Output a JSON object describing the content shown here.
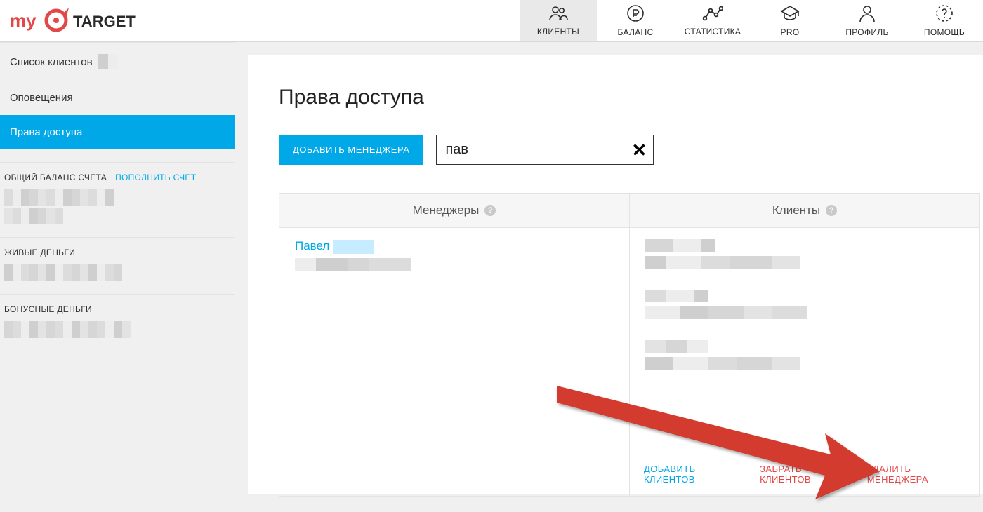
{
  "logo": {
    "text_left": "my",
    "text_right": "TARGET"
  },
  "topnav": [
    {
      "name": "clients",
      "label": "КЛИЕНТЫ",
      "active": true
    },
    {
      "name": "balance",
      "label": "БАЛАНС",
      "active": false
    },
    {
      "name": "stats",
      "label": "СТАТИСТИКА",
      "active": false
    },
    {
      "name": "pro",
      "label": "PRO",
      "active": false
    },
    {
      "name": "profile",
      "label": "ПРОФИЛЬ",
      "active": false
    },
    {
      "name": "help",
      "label": "ПОМОЩЬ",
      "active": false
    }
  ],
  "sidebar": {
    "items": [
      {
        "label": "Список клиентов",
        "active": false
      },
      {
        "label": "Оповещения",
        "active": false
      },
      {
        "label": "Права доступа",
        "active": true
      }
    ],
    "balance_header": "ОБЩИЙ БАЛАНС СЧЕТА",
    "balance_link": "ПОПОЛНИТЬ СЧЕТ",
    "live_money": "ЖИВЫЕ ДЕНЬГИ",
    "bonus_money": "БОНУСНЫЕ ДЕНЬГИ"
  },
  "page": {
    "title": "Права доступа",
    "add_button": "ДОБАВИТЬ МЕНЕДЖЕРА",
    "search_value": "пав"
  },
  "table": {
    "col_managers": "Менеджеры",
    "col_clients": "Клиенты",
    "manager_name": "Павел"
  },
  "actions": {
    "add_clients": "ДОБАВИТЬ КЛИЕНТОВ",
    "remove_clients": "ЗАБРАТЬ КЛИЕНТОВ",
    "delete_manager": "УДАЛИТЬ МЕНЕДЖЕРА"
  }
}
